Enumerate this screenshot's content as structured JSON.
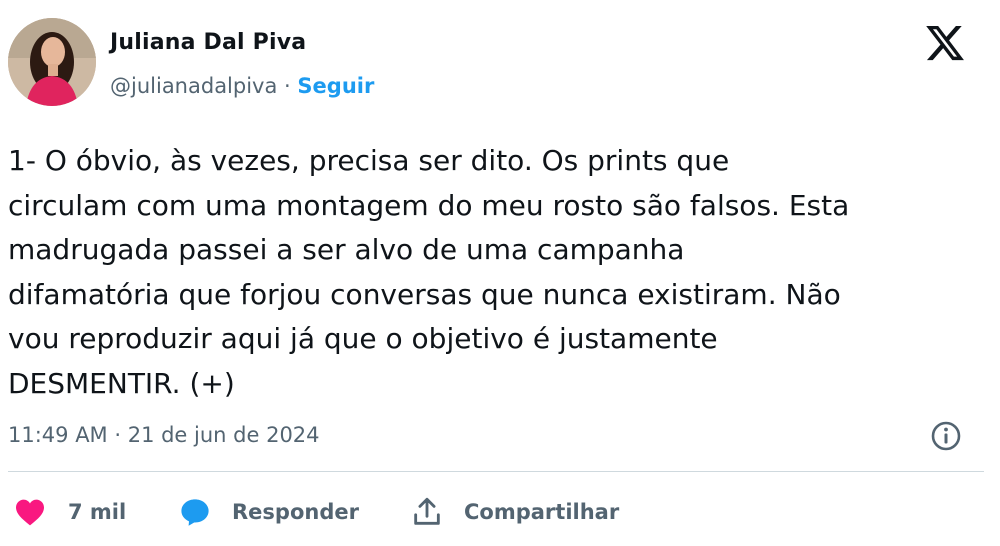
{
  "author": {
    "name": "Juliana Dal Piva",
    "handle": "@julianadalpiva",
    "separator": "·",
    "follow_label": "Seguir"
  },
  "tweet": {
    "text": "1- O óbvio, às vezes, precisa ser dito. Os prints que\ncirculam com uma montagem do meu rosto são falsos. Esta\nmadrugada passei a ser alvo de uma campanha\ndifamatória que forjou conversas que nunca existiram. Não\nvou reproduzir aqui já que o objetivo é justamente\nDESMENTIR. (+)",
    "timestamp": "11:49 AM · 21 de jun de 2024"
  },
  "actions": {
    "like_count": "7 mil",
    "reply_label": "Responder",
    "share_label": "Compartilhar"
  },
  "colors": {
    "accent": "#1d9bf0",
    "like": "#f91880",
    "muted_text": "#536471",
    "text": "#0f1419",
    "divider": "#cfd9de"
  },
  "icons": [
    "x-logo-icon",
    "info-icon",
    "heart-icon",
    "reply-bubble-icon",
    "share-icon"
  ]
}
